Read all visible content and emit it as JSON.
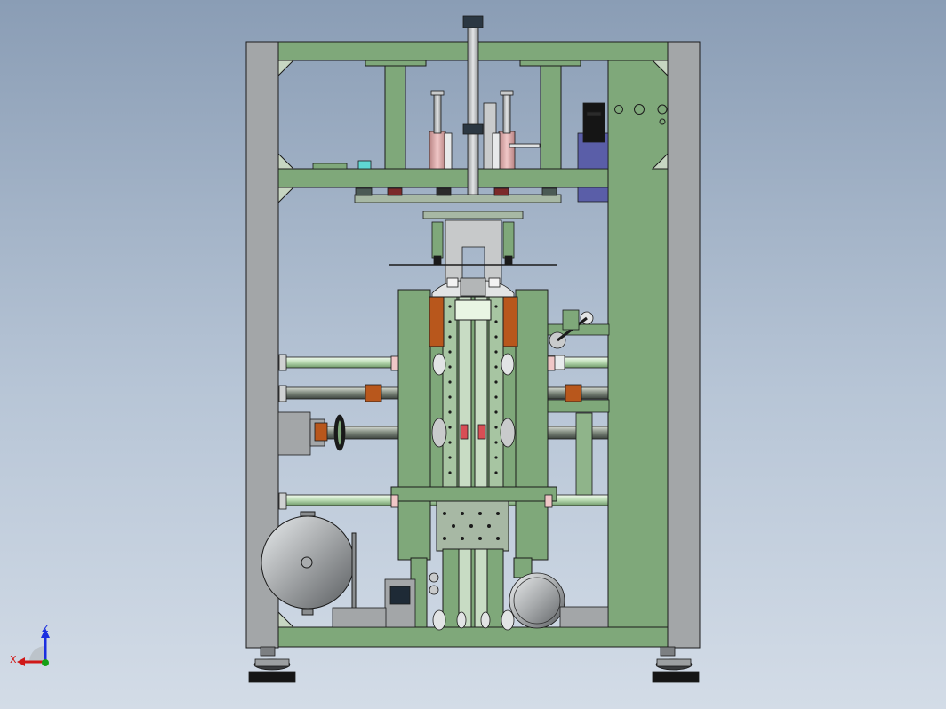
{
  "triad": {
    "z_label": "Z",
    "x_label": "X",
    "colors": {
      "z": "#1a2ee0",
      "x": "#d01818",
      "y": "#16a016"
    }
  },
  "palette": {
    "frame_steel": "#a3a6a8",
    "machine_green": "#7fa87a",
    "green_dark": "#5f8a5d",
    "rod_light": "#cfe6c8",
    "copper": "#b8571c",
    "pink_part": "#d84e55",
    "blue_motor": "#5a5ea8",
    "tank_gray": "#a9acae",
    "outline": "#1b1b1b"
  }
}
